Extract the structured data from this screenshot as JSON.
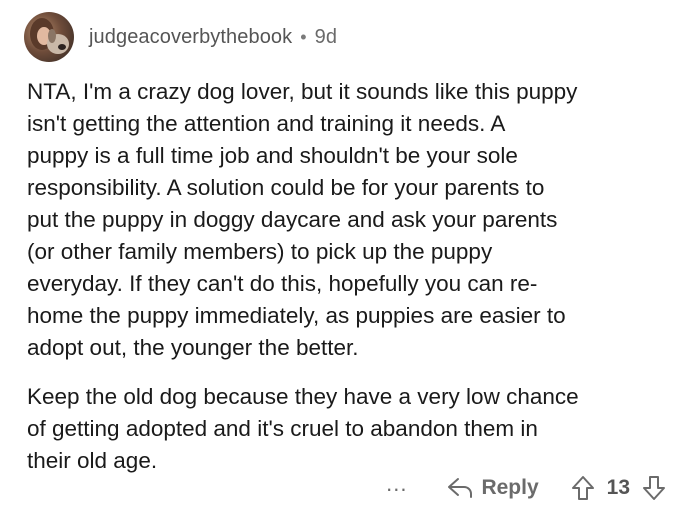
{
  "comment": {
    "username": "judgeacoverbythebook",
    "separator": "•",
    "age": "9d",
    "paragraphs": [
      {
        "lines": [
          "NTA, I'm a crazy dog lover, but it sounds like this puppy",
          "isn't getting the attention and training it needs.  A",
          "puppy is a full time job and shouldn't be your sole",
          "responsibility. A solution could be for your parents to",
          "put the puppy in doggy daycare and ask your parents",
          "(or other family members) to pick up the puppy",
          "everyday. If they can't do this, hopefully you can re-",
          "home the puppy immediately, as puppies are easier to",
          "adopt out, the younger the better."
        ]
      },
      {
        "lines": [
          "Keep the old dog because they have a very low chance",
          "of getting adopted and it's cruel to abandon them in",
          "their old age."
        ]
      }
    ],
    "actions": {
      "more_label": "...",
      "reply_label": "Reply",
      "score": "13"
    }
  }
}
